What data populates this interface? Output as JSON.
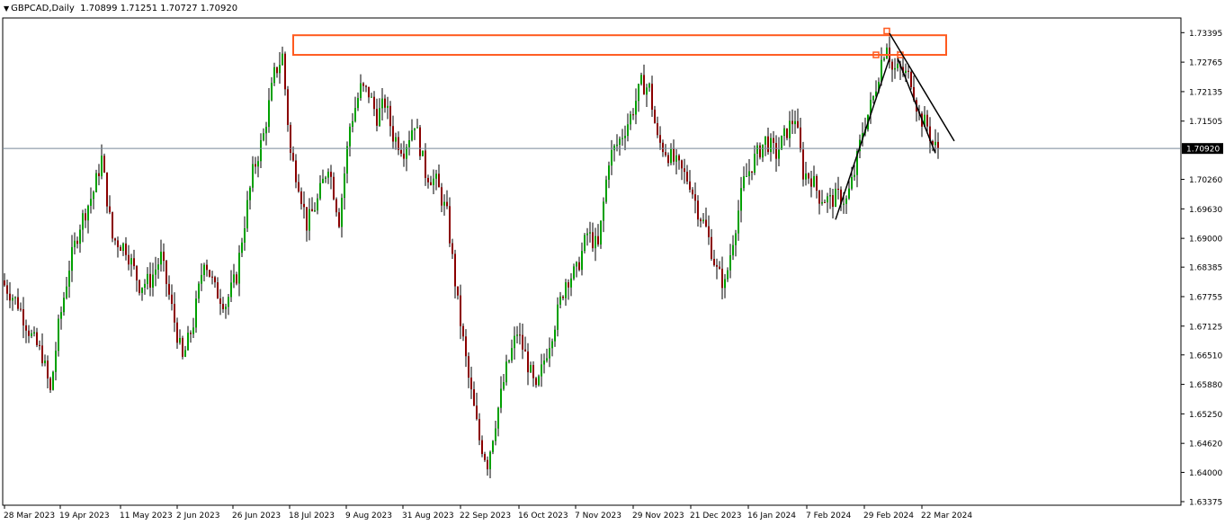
{
  "window": {
    "symbol": "GBPCAD,Daily",
    "ohlc_readout": "1.70899 1.71251 1.70727 1.70920"
  },
  "chart_data": {
    "type": "candlestick",
    "symbol": "GBPCAD",
    "timeframe": "Daily",
    "ylim": [
      1.63375,
      1.7367
    ],
    "y_ticks": [
      "1.73395",
      "1.72765",
      "1.72135",
      "1.71505",
      "1.70260",
      "1.69630",
      "1.69000",
      "1.68385",
      "1.67755",
      "1.67125",
      "1.66510",
      "1.65880",
      "1.65250",
      "1.64620",
      "1.64000",
      "1.63375"
    ],
    "current_price": "1.70920",
    "x_ticks": [
      "28 Mar 2023",
      "19 Apr 2023",
      "11 May 2023",
      "2 Jun 2023",
      "26 Jun 2023",
      "18 Jul 2023",
      "9 Aug 2023",
      "31 Aug 2023",
      "22 Sep 2023",
      "16 Oct 2023",
      "7 Nov 2023",
      "29 Nov 2023",
      "21 Dec 2023",
      "16 Jan 2024",
      "7 Feb 2024",
      "29 Feb 2024",
      "22 Mar 2024"
    ],
    "grid": false,
    "colors": {
      "bull": "#00a000",
      "bear": "#8b0000",
      "wick": "#000000",
      "zone": "#ff5a1f",
      "price_line": "#778899",
      "background": "#ffffff"
    },
    "anchors": [
      {
        "i": 0,
        "c": 1.68
      },
      {
        "i": 5,
        "c": 1.676
      },
      {
        "i": 10,
        "c": 1.669
      },
      {
        "i": 14,
        "c": 1.665
      },
      {
        "i": 17,
        "c": 1.657
      },
      {
        "i": 20,
        "c": 1.671
      },
      {
        "i": 24,
        "c": 1.684
      },
      {
        "i": 28,
        "c": 1.693
      },
      {
        "i": 33,
        "c": 1.7
      },
      {
        "i": 36,
        "c": 1.707
      },
      {
        "i": 40,
        "c": 1.69
      },
      {
        "i": 45,
        "c": 1.688
      },
      {
        "i": 50,
        "c": 1.68
      },
      {
        "i": 54,
        "c": 1.681
      },
      {
        "i": 58,
        "c": 1.686
      },
      {
        "i": 62,
        "c": 1.675
      },
      {
        "i": 66,
        "c": 1.664
      },
      {
        "i": 70,
        "c": 1.672
      },
      {
        "i": 74,
        "c": 1.686
      },
      {
        "i": 78,
        "c": 1.679
      },
      {
        "i": 82,
        "c": 1.676
      },
      {
        "i": 86,
        "c": 1.682
      },
      {
        "i": 88,
        "c": 1.69
      },
      {
        "i": 92,
        "c": 1.704
      },
      {
        "i": 96,
        "c": 1.712
      },
      {
        "i": 100,
        "c": 1.725
      },
      {
        "i": 103,
        "c": 1.729
      },
      {
        "i": 106,
        "c": 1.708
      },
      {
        "i": 109,
        "c": 1.702
      },
      {
        "i": 112,
        "c": 1.693
      },
      {
        "i": 116,
        "c": 1.698
      },
      {
        "i": 120,
        "c": 1.706
      },
      {
        "i": 124,
        "c": 1.694
      },
      {
        "i": 128,
        "c": 1.714
      },
      {
        "i": 132,
        "c": 1.722
      },
      {
        "i": 135,
        "c": 1.721
      },
      {
        "i": 138,
        "c": 1.716
      },
      {
        "i": 141,
        "c": 1.719
      },
      {
        "i": 144,
        "c": 1.712
      },
      {
        "i": 148,
        "c": 1.709
      },
      {
        "i": 152,
        "c": 1.715
      },
      {
        "i": 156,
        "c": 1.704
      },
      {
        "i": 160,
        "c": 1.702
      },
      {
        "i": 164,
        "c": 1.695
      },
      {
        "i": 168,
        "c": 1.676
      },
      {
        "i": 172,
        "c": 1.66
      },
      {
        "i": 176,
        "c": 1.647
      },
      {
        "i": 179,
        "c": 1.642
      },
      {
        "i": 182,
        "c": 1.651
      },
      {
        "i": 186,
        "c": 1.662
      },
      {
        "i": 190,
        "c": 1.67
      },
      {
        "i": 193,
        "c": 1.665
      },
      {
        "i": 197,
        "c": 1.657
      },
      {
        "i": 200,
        "c": 1.664
      },
      {
        "i": 204,
        "c": 1.672
      },
      {
        "i": 208,
        "c": 1.681
      },
      {
        "i": 212,
        "c": 1.683
      },
      {
        "i": 216,
        "c": 1.691
      },
      {
        "i": 220,
        "c": 1.688
      },
      {
        "i": 224,
        "c": 1.707
      },
      {
        "i": 228,
        "c": 1.711
      },
      {
        "i": 232,
        "c": 1.716
      },
      {
        "i": 236,
        "c": 1.723
      },
      {
        "i": 239,
        "c": 1.722
      },
      {
        "i": 242,
        "c": 1.711
      },
      {
        "i": 246,
        "c": 1.708
      },
      {
        "i": 250,
        "c": 1.705
      },
      {
        "i": 254,
        "c": 1.702
      },
      {
        "i": 257,
        "c": 1.696
      },
      {
        "i": 260,
        "c": 1.692
      },
      {
        "i": 264,
        "c": 1.683
      },
      {
        "i": 267,
        "c": 1.68
      },
      {
        "i": 270,
        "c": 1.69
      },
      {
        "i": 274,
        "c": 1.702
      },
      {
        "i": 278,
        "c": 1.707
      },
      {
        "i": 282,
        "c": 1.711
      },
      {
        "i": 286,
        "c": 1.708
      },
      {
        "i": 290,
        "c": 1.713
      },
      {
        "i": 293,
        "c": 1.716
      },
      {
        "i": 296,
        "c": 1.704
      },
      {
        "i": 299,
        "c": 1.703
      },
      {
        "i": 302,
        "c": 1.699
      },
      {
        "i": 306,
        "c": 1.698
      },
      {
        "i": 309,
        "c": 1.699
      },
      {
        "i": 312,
        "c": 1.698
      },
      {
        "i": 315,
        "c": 1.704
      },
      {
        "i": 318,
        "c": 1.713
      },
      {
        "i": 322,
        "c": 1.72
      },
      {
        "i": 325,
        "c": 1.728
      },
      {
        "i": 327,
        "c": 1.732
      },
      {
        "i": 329,
        "c": 1.726
      },
      {
        "i": 332,
        "c": 1.726
      },
      {
        "i": 336,
        "c": 1.724
      },
      {
        "i": 339,
        "c": 1.716
      },
      {
        "i": 342,
        "c": 1.714
      },
      {
        "i": 344,
        "c": 1.71
      },
      {
        "i": 346,
        "c": 1.709
      }
    ],
    "shapes": {
      "resistance_zone": {
        "x1": 107,
        "x2": 349,
        "y_top": 1.7334,
        "y_bottom": 1.7292
      },
      "markers": [
        {
          "x": 327,
          "y": 1.7343
        },
        {
          "x": 323,
          "y": 1.7292
        },
        {
          "x": 332,
          "y": 1.7292
        }
      ],
      "trendlines": [
        {
          "x1": 308,
          "y1": 1.694,
          "x2": 328,
          "y2": 1.7285
        },
        {
          "x1": 328,
          "y1": 1.7338,
          "x2": 352,
          "y2": 1.7108
        },
        {
          "x1": 331,
          "y1": 1.7285,
          "x2": 345,
          "y2": 1.7082
        }
      ]
    }
  }
}
